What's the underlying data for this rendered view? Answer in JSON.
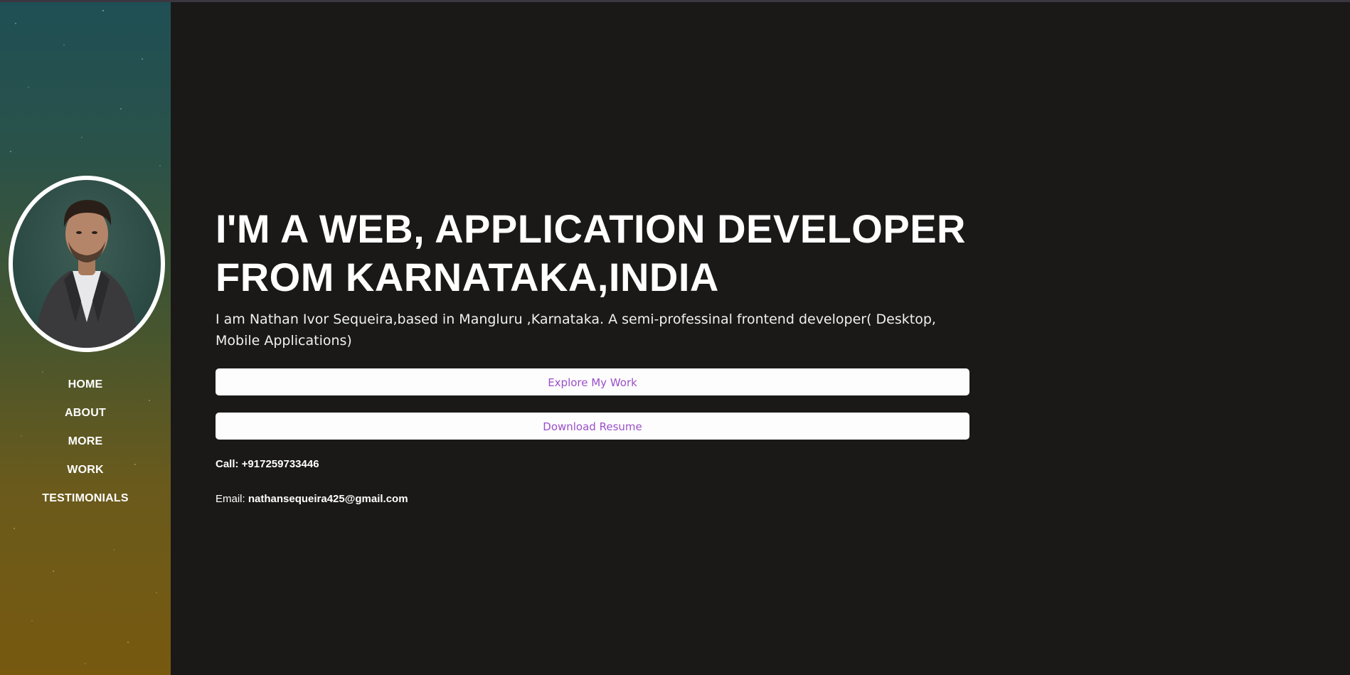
{
  "sidebar": {
    "avatar_icon": "profile-photo",
    "nav": [
      {
        "label": "HOME"
      },
      {
        "label": "ABOUT"
      },
      {
        "label": "MORE"
      },
      {
        "label": "WORK"
      },
      {
        "label": "TESTIMONIALS"
      }
    ]
  },
  "hero": {
    "headline_line1": "I'M A WEB, APPLICATION DEVELOPER",
    "headline_line2": "FROM KARNATAKA,INDIA",
    "intro": "I am Nathan Ivor Sequeira,based in Mangluru ,Karnataka. A semi-professinal frontend developer( Desktop, Mobile Applications)",
    "explore_label": "Explore My Work",
    "resume_label": "Download Resume",
    "call_text": "Call: +917259733446",
    "email_prefix": "Email: ",
    "email_address": "nathansequeira425@gmail.com"
  },
  "colors": {
    "background": "#1a1918",
    "button_text": "#9b4fc9",
    "sidebar_top": "#1f4f55",
    "sidebar_bottom": "#77590f"
  }
}
